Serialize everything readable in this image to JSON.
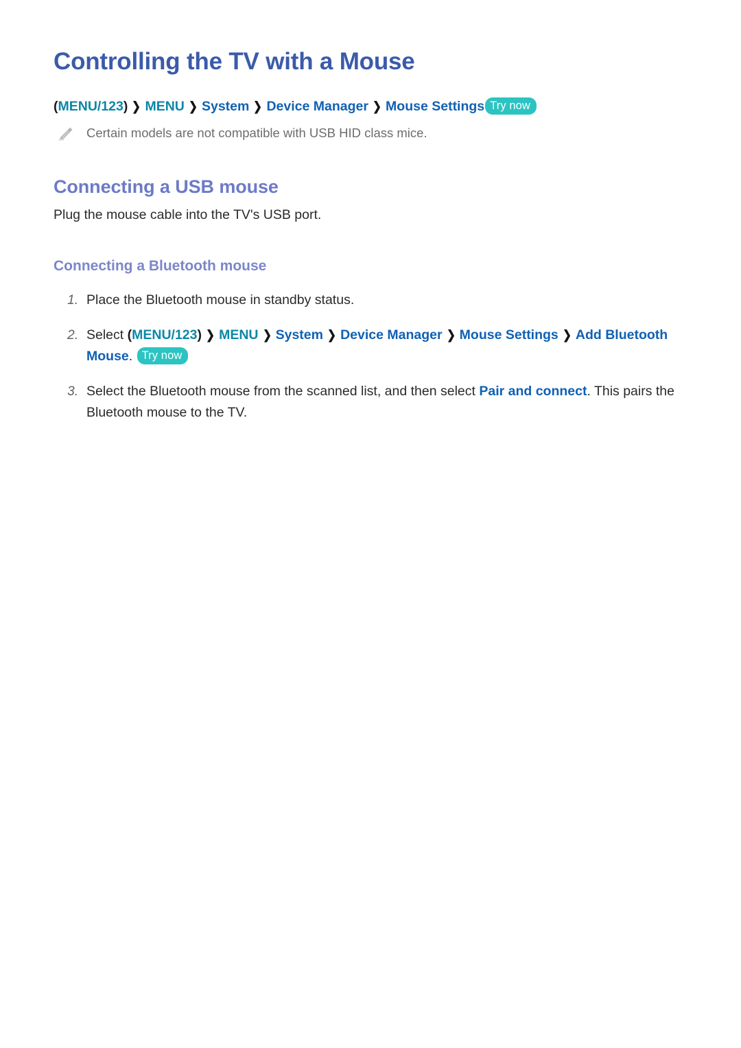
{
  "page": {
    "title": "Controlling the TV with a Mouse"
  },
  "breadcrumb": {
    "open_paren": "(",
    "close_paren": ")",
    "separator": "❯",
    "items": [
      {
        "label": "MENU/123",
        "color": "teal"
      },
      {
        "label": "MENU",
        "color": "teal"
      },
      {
        "label": "System",
        "color": "blue"
      },
      {
        "label": "Device Manager",
        "color": "blue"
      },
      {
        "label": "Mouse Settings",
        "color": "blue"
      }
    ],
    "try_now_label": "Try now"
  },
  "note": {
    "icon": "pencil-icon",
    "text": "Certain models are not compatible with USB HID class mice."
  },
  "sections": [
    {
      "heading": "Connecting a USB mouse",
      "paragraph": "Plug the mouse cable into the TV's USB port."
    },
    {
      "heading": "Connecting a Bluetooth mouse"
    }
  ],
  "steps": [
    {
      "num": "1.",
      "text": "Place the Bluetooth mouse in standby status."
    },
    {
      "num": "2.",
      "prefix": "Select ",
      "open_paren": "(",
      "close_paren": ")",
      "crumbs": [
        {
          "label": "MENU/123",
          "color": "teal"
        },
        {
          "label": "MENU",
          "color": "teal"
        },
        {
          "label": "System",
          "color": "blue"
        },
        {
          "label": "Device Manager",
          "color": "blue"
        },
        {
          "label": "Mouse Settings",
          "color": "blue"
        },
        {
          "label": "Add Bluetooth Mouse",
          "color": "blue"
        }
      ],
      "suffix": ".",
      "try_now_label": "Try now"
    },
    {
      "num": "3.",
      "prefix": "Select the Bluetooth mouse from the scanned list, and then select ",
      "keyword": "Pair and connect",
      "suffix": ". This pairs the Bluetooth mouse to the TV."
    }
  ],
  "colors": {
    "title": "#3b5ba9",
    "heading_h2": "#6d7ac8",
    "heading_h3": "#7c86c9",
    "crumb_teal": "#0b87a8",
    "crumb_blue": "#1061b4",
    "try_now_bg": "#2bc4c2",
    "note_text": "#6d6d6d",
    "body_text": "#2a2a2a"
  }
}
